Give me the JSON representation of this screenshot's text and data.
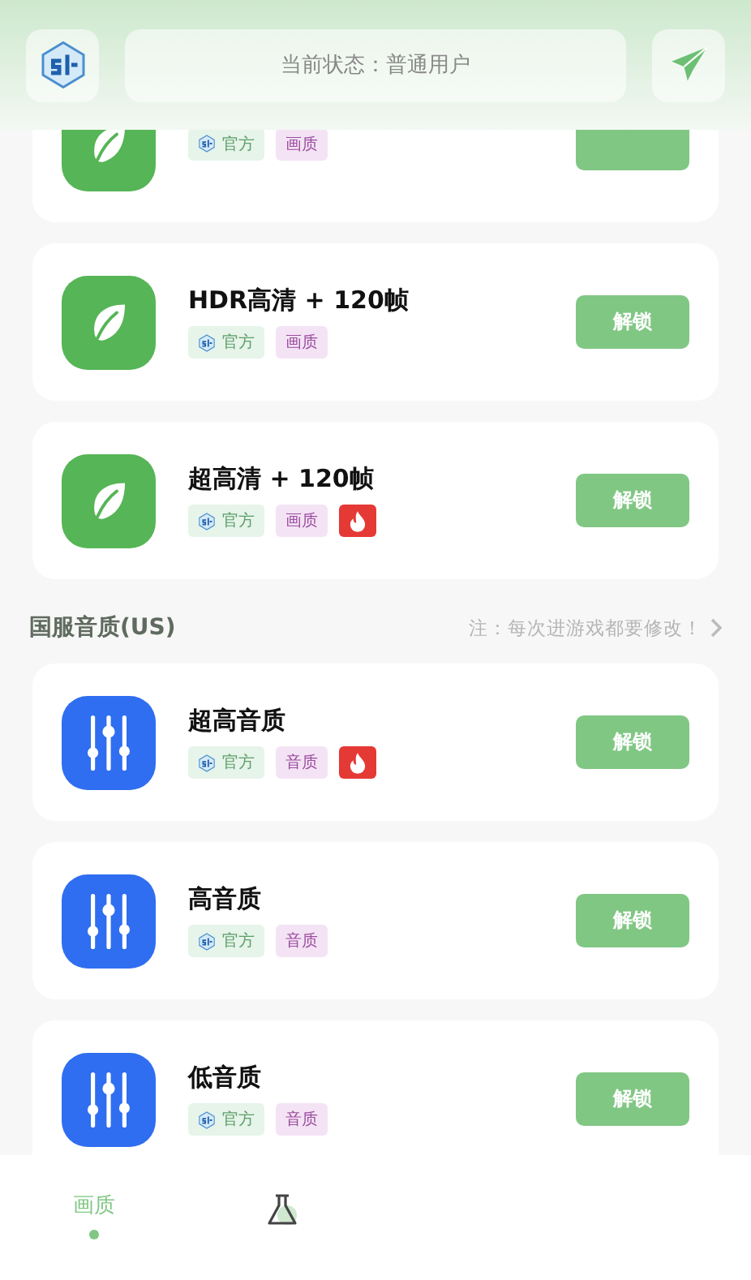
{
  "header": {
    "status": "当前状态：普通用户"
  },
  "sections": [
    {
      "cards": [
        {
          "kind": "leaf",
          "partial": true,
          "tags": [
            {
              "kind": "official",
              "label": "官方"
            },
            {
              "kind": "category",
              "label": "画质"
            }
          ]
        },
        {
          "kind": "leaf",
          "partial": false,
          "title": "HDR高清 + 120帧",
          "button": "解锁",
          "tags": [
            {
              "kind": "official",
              "label": "官方"
            },
            {
              "kind": "category",
              "label": "画质"
            }
          ]
        },
        {
          "kind": "leaf",
          "partial": false,
          "title": "超高清 + 120帧",
          "button": "解锁",
          "tags": [
            {
              "kind": "official",
              "label": "官方"
            },
            {
              "kind": "category",
              "label": "画质"
            },
            {
              "kind": "hot"
            }
          ]
        }
      ]
    },
    {
      "title": "国服音质(US)",
      "note": "注：每次进游戏都要修改！",
      "cards": [
        {
          "kind": "equalizer",
          "partial": false,
          "title": "超高音质",
          "button": "解锁",
          "tags": [
            {
              "kind": "official",
              "label": "官方"
            },
            {
              "kind": "category",
              "label": "音质"
            },
            {
              "kind": "hot"
            }
          ]
        },
        {
          "kind": "equalizer",
          "partial": false,
          "title": "高音质",
          "button": "解锁",
          "tags": [
            {
              "kind": "official",
              "label": "官方"
            },
            {
              "kind": "category",
              "label": "音质"
            }
          ]
        },
        {
          "kind": "equalizer",
          "partial": false,
          "title": "低音质",
          "button": "解锁",
          "tags": [
            {
              "kind": "official",
              "label": "官方"
            },
            {
              "kind": "category",
              "label": "音质"
            }
          ]
        }
      ]
    }
  ],
  "tabs": [
    {
      "kind": "text",
      "label": "画质",
      "selected": true
    },
    {
      "kind": "flask",
      "selected": false
    }
  ]
}
